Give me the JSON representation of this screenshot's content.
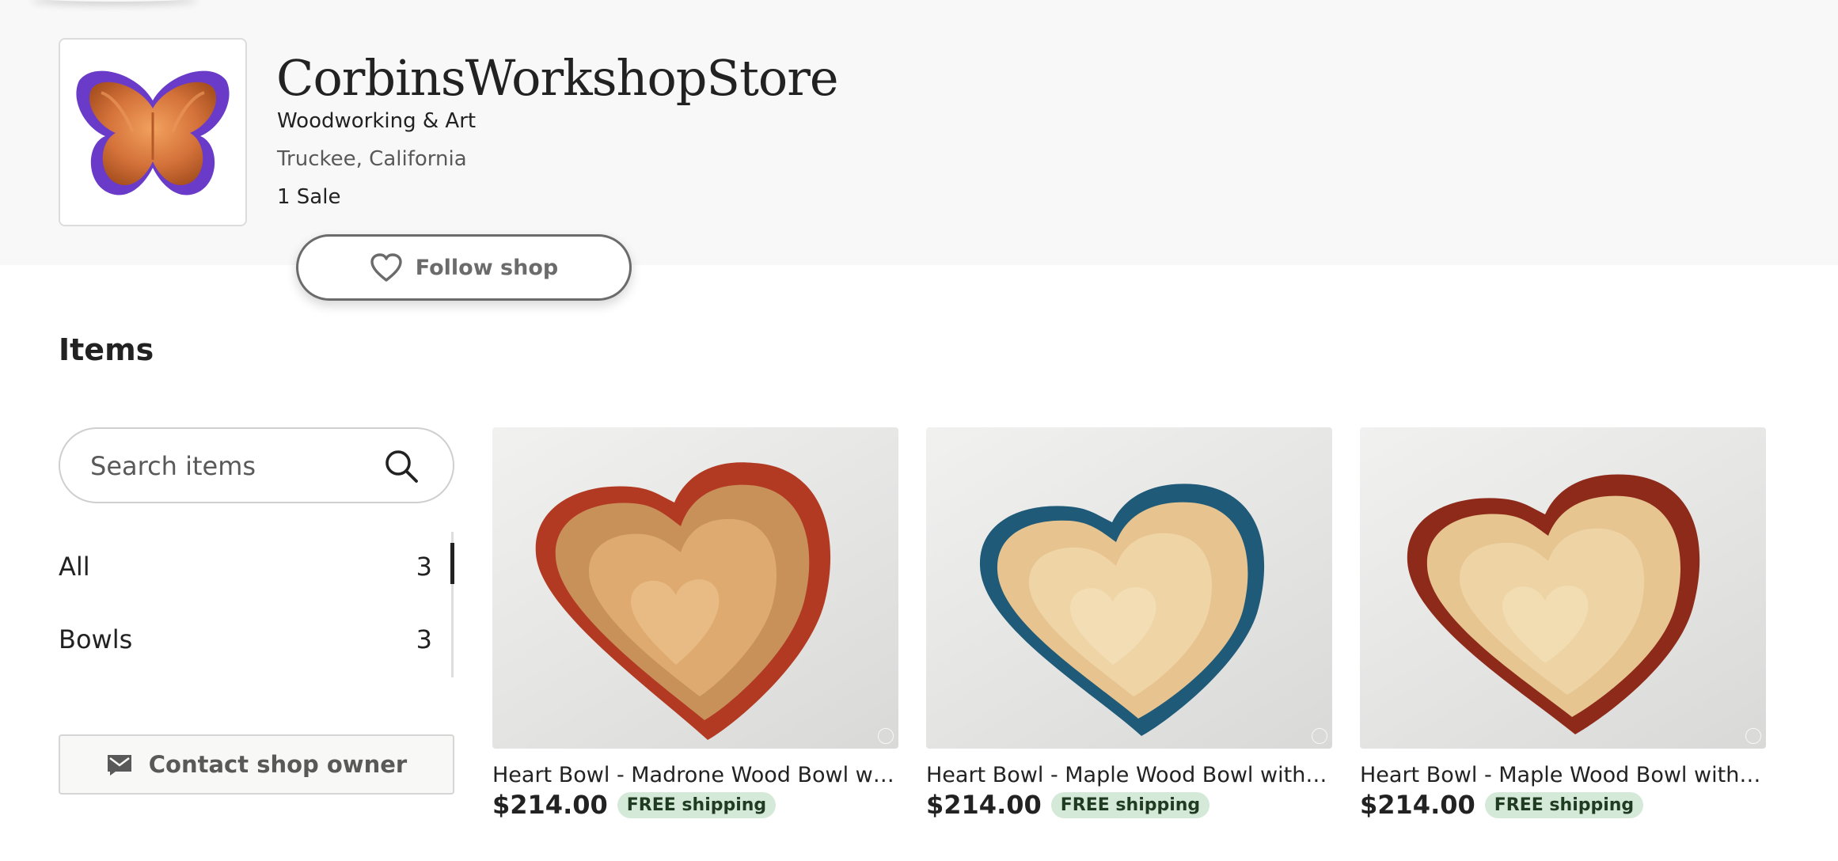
{
  "shop": {
    "name": "CorbinsWorkshopStore",
    "tagline": "Woodworking & Art",
    "location": "Truckee, California",
    "sales": "1 Sale",
    "logo_icon": "butterfly-bowl-image",
    "follow_label": "Follow shop"
  },
  "items_section": {
    "title": "Items",
    "search": {
      "placeholder": "Search items",
      "value": ""
    },
    "categories": [
      {
        "label": "All",
        "count": "3",
        "active": true
      },
      {
        "label": "Bowls",
        "count": "3",
        "active": false
      }
    ],
    "contact_label": "Contact shop owner"
  },
  "listings": [
    {
      "title": "Heart Bowl - Madrone Wood Bowl with ...",
      "price": "$214.00",
      "shipping": "FREE shipping",
      "rim_color": "#b23a22"
    },
    {
      "title": "Heart Bowl - Maple Wood Bowl with Bor...",
      "price": "$214.00",
      "shipping": "FREE shipping",
      "rim_color": "#1f5a78"
    },
    {
      "title": "Heart Bowl - Maple Wood Bowl with Dar...",
      "price": "$214.00",
      "shipping": "FREE shipping",
      "rim_color": "#8e2a1a"
    }
  ],
  "colors": {
    "header_background": "#f8f8f8",
    "badge_background": "#d4e9d7",
    "text_primary": "#222222",
    "text_secondary": "#595959"
  },
  "icons": {
    "follow": "heart-outline-icon",
    "search": "search-icon",
    "contact": "envelope-icon"
  }
}
